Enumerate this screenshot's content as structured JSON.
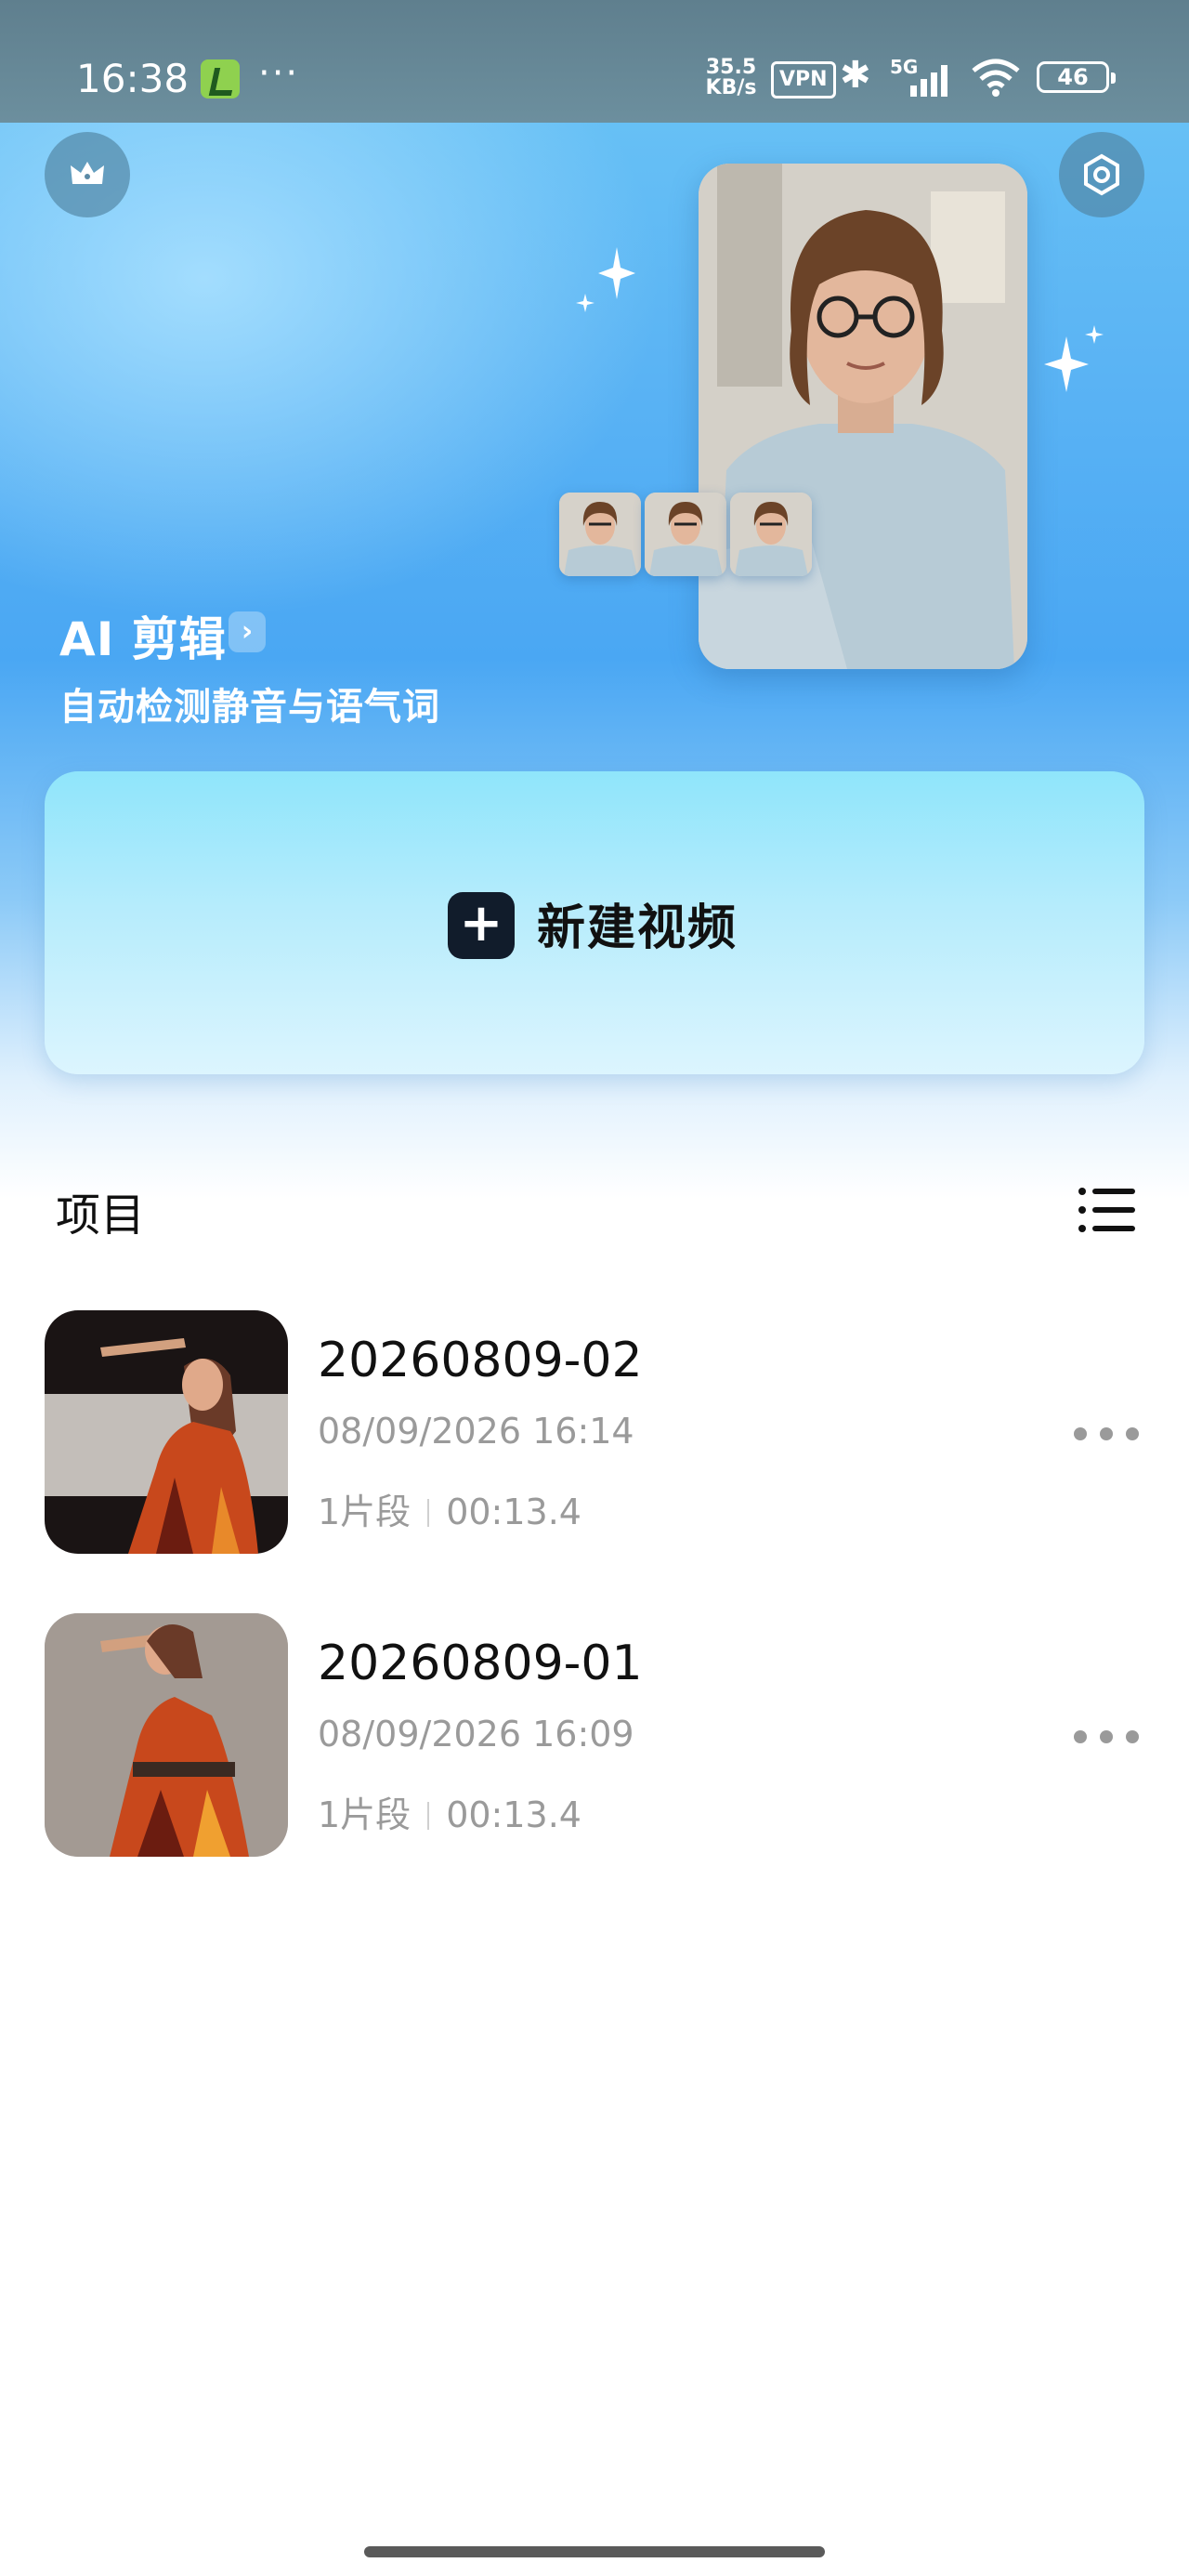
{
  "status_bar": {
    "time": "16:38",
    "more": "···",
    "network_speed_value": "35.5",
    "network_speed_unit": "KB/s",
    "vpn": "VPN",
    "network_type": "5G",
    "battery": "46"
  },
  "hero": {
    "title": "AI 剪辑",
    "title_arrow": "›",
    "subtitle": "自动检测静音与语气词"
  },
  "new_video": {
    "plus": "+",
    "label": "新建视频"
  },
  "projects": {
    "section_title": "项目",
    "items": [
      {
        "name": "20260809-02",
        "date": "08/09/2026 16:14",
        "segments": "1片段",
        "duration": "00:13.4"
      },
      {
        "name": "20260809-01",
        "date": "08/09/2026 16:09",
        "segments": "1片段",
        "duration": "00:13.4"
      }
    ]
  },
  "colors": {
    "hero_blue": "#4aa7f3",
    "new_video_card": "#b6ecfc",
    "muted_text": "#9a9a9a"
  }
}
